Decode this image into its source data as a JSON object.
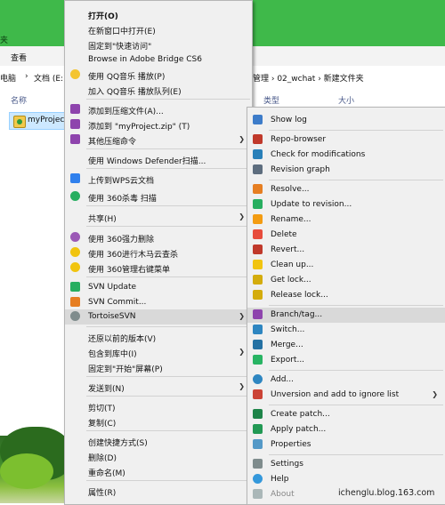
{
  "explorer": {
    "window_title_fragment": "夹",
    "ribbon_tab": "查看",
    "breadcrumb": {
      "root": "电脑",
      "sep1": "›",
      "drive": "文档 (E:)",
      "sep2": "›",
      "right_part": "管理  ›  02_wchat  ›  新建文件夹"
    },
    "column_headers": {
      "name": "名称",
      "type": "类型",
      "size": "大小"
    },
    "file_name": "myProject"
  },
  "context_menu": {
    "open": "打开(O)",
    "open_new_window": "在新窗口中打开(E)",
    "pin_quick_access": "固定到\"快速访问\"",
    "browse_bridge": "Browse in Adobe Bridge CS6",
    "qq_play": "使用 QQ音乐 播放(P)",
    "qq_queue": "加入 QQ音乐 播放队列(E)",
    "add_archive": "添加到压缩文件(A)...",
    "add_zip": "添加到 \"myProject.zip\" (T)",
    "other_compress": "其他压缩命令",
    "defender": "使用 Windows Defender扫描...",
    "wps_upload": "上传到WPS云文档",
    "scan_360": "使用 360杀毒 扫描",
    "share": "共享(H)",
    "force_delete_360": "使用 360强力删除",
    "trojan_360": "使用 360进行木马云查杀",
    "manage_menu_360": "使用 360管理右键菜单",
    "svn_update": "SVN Update",
    "svn_commit": "SVN Commit...",
    "tortoise": "TortoiseSVN",
    "restore_prev": "还原以前的版本(V)",
    "include_library": "包含到库中(I)",
    "pin_start": "固定到\"开始\"屏幕(P)",
    "send_to": "发送到(N)",
    "cut": "剪切(T)",
    "copy": "复制(C)",
    "create_shortcut": "创建快捷方式(S)",
    "delete": "删除(D)",
    "rename": "重命名(M)",
    "properties": "属性(R)"
  },
  "tortoise_menu": {
    "show_log": "Show log",
    "repo_browser": "Repo-browser",
    "check_modifications": "Check for modifications",
    "revision_graph": "Revision graph",
    "resolve": "Resolve...",
    "update_revision": "Update to revision...",
    "rename": "Rename...",
    "delete": "Delete",
    "revert": "Revert...",
    "clean_up": "Clean up...",
    "get_lock": "Get lock...",
    "release_lock": "Release lock...",
    "branch_tag": "Branch/tag...",
    "switch": "Switch...",
    "merge": "Merge...",
    "export": "Export...",
    "add": "Add...",
    "unversion_ignore": "Unversion and add to ignore list",
    "create_patch": "Create patch...",
    "apply_patch": "Apply patch...",
    "properties": "Properties",
    "settings": "Settings",
    "help": "Help",
    "about": "About"
  },
  "watermark": "ichenglu.blog.163.com",
  "colors": {
    "titlebar_green": "#3fb94a",
    "menu_bg": "#f0f0f0",
    "highlight": "#d9d9d9",
    "selection_blue": "#cce8ff"
  }
}
